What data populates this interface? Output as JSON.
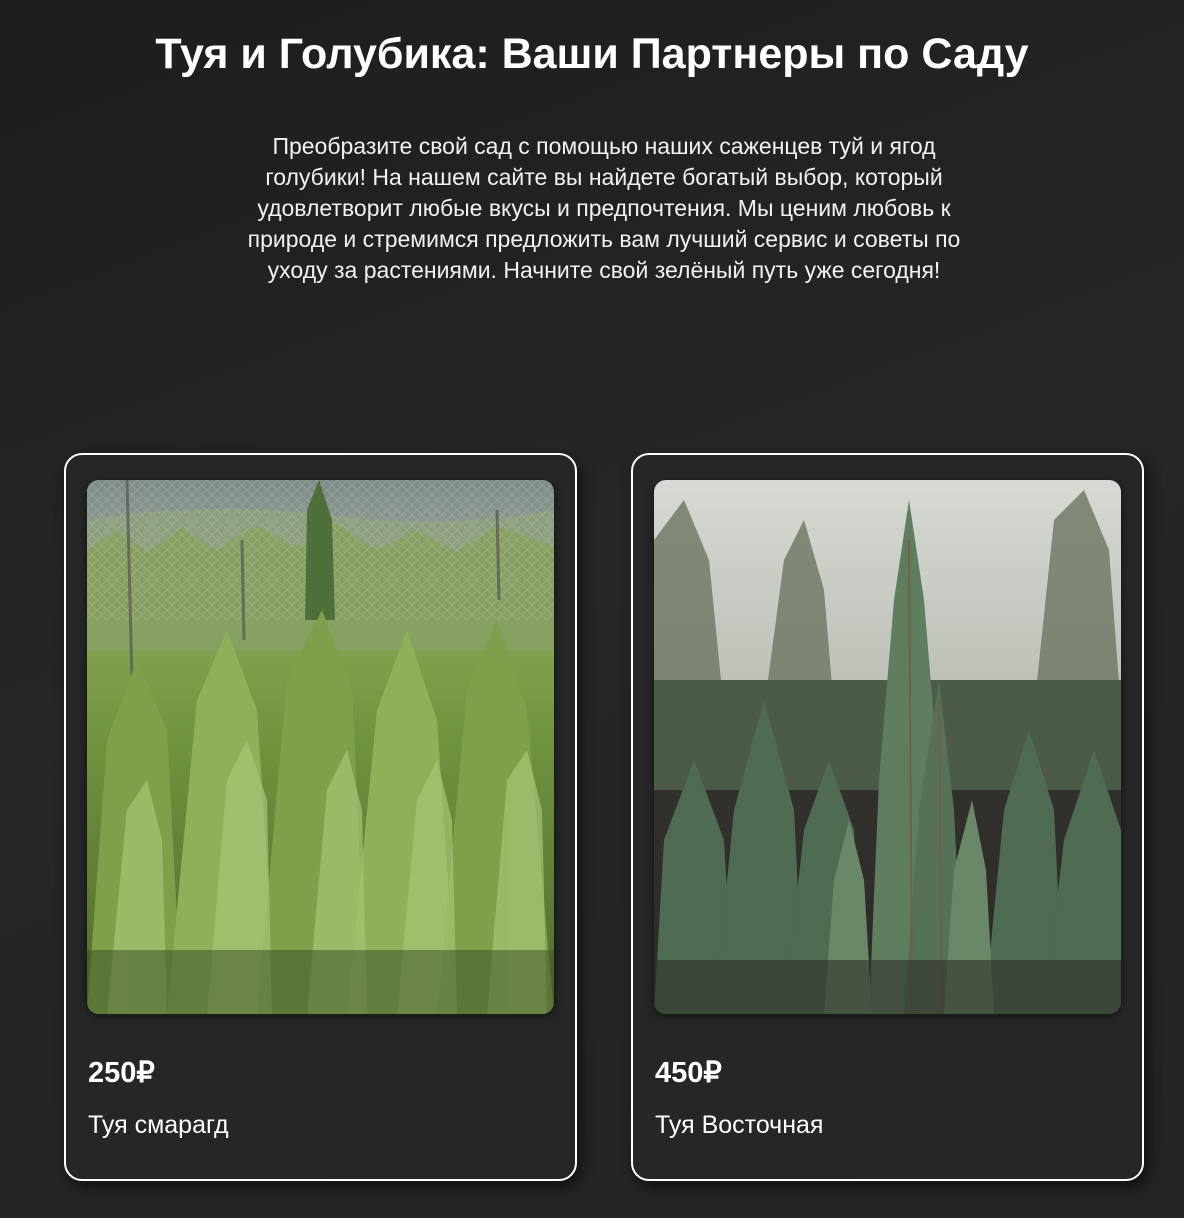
{
  "header": {
    "title": "Туя и Голубика: Ваши Партнеры по Саду",
    "intro": "Преобразите свой сад с помощью наших саженцев туй и ягод голубики! На нашем сайте вы найдете богатый выбор, который удовлетворит любые вкусы и предпочтения. Мы ценим любовь к природе и стремимся предложить вам лучший сервис и советы по уходу за растениями. Начните свой зелёный путь уже сегодня!"
  },
  "products": [
    {
      "price": "250₽",
      "name": "Туя смарагд",
      "image": "thuja-smaragd-photo"
    },
    {
      "price": "450₽",
      "name": "Туя Восточная",
      "image": "thuja-orientalis-photo"
    }
  ],
  "colors": {
    "background": "#232323",
    "card_border": "#ffffff",
    "text": "#ffffff"
  }
}
